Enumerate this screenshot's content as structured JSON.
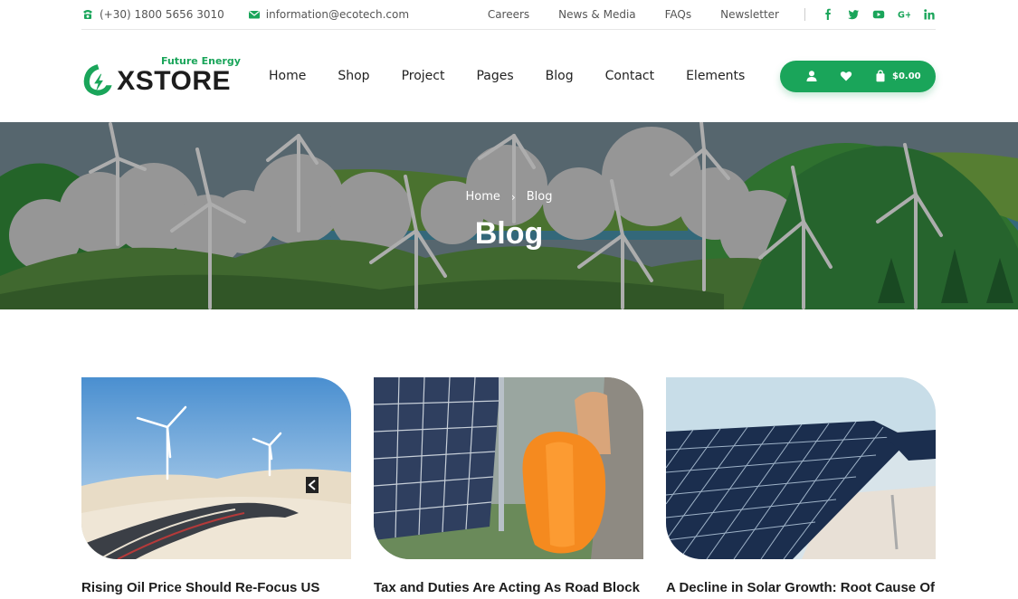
{
  "topbar": {
    "phone": "(+30) 1800 5656 3010",
    "email": "information@ecotech.com",
    "links": [
      "Careers",
      "News & Media",
      "FAQs",
      "Newsletter"
    ],
    "social_icons": [
      "facebook-icon",
      "twitter-icon",
      "youtube-icon",
      "google-plus-icon",
      "linkedin-icon"
    ]
  },
  "header": {
    "logo_tagline": "Future Energy",
    "logo_text": "XSTORE",
    "nav": [
      "Home",
      "Shop",
      "Project",
      "Pages",
      "Blog",
      "Contact",
      "Elements"
    ],
    "cart_total": "$0.00"
  },
  "banner": {
    "breadcrumb_home": "Home",
    "breadcrumb_current": "Blog",
    "title": "Blog"
  },
  "posts": [
    {
      "title": "Rising Oil Price Should Re-Focus US Than Solar Energy Growth"
    },
    {
      "title": "Tax and Duties Are Acting As Road Block for Power for All"
    },
    {
      "title": "A Decline in Solar Growth: Root Cause Of Analysis Records"
    }
  ],
  "colors": {
    "accent": "#1aa55a",
    "text_dark": "#1d1d1d"
  }
}
